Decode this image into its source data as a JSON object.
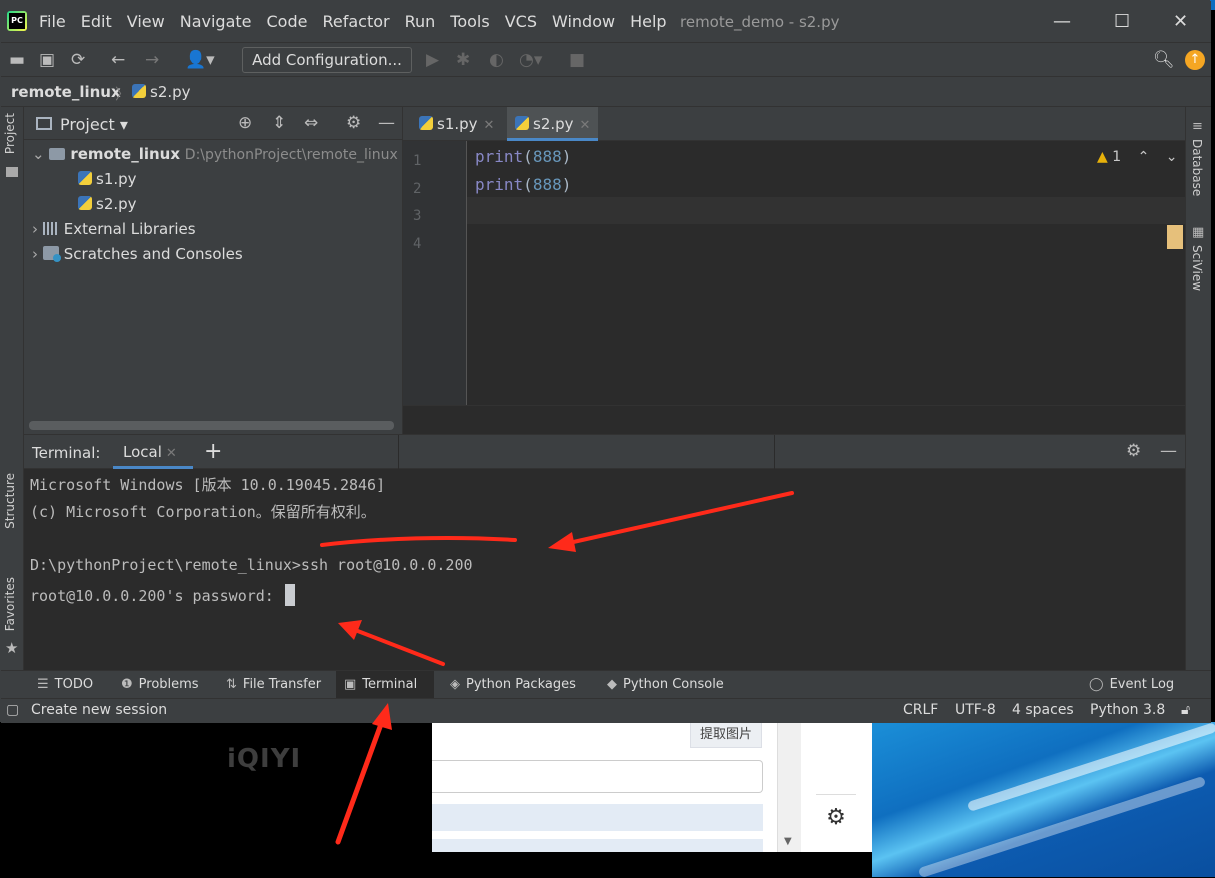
{
  "window": {
    "title": "remote_demo - s2.py",
    "controls": {
      "minimize": "—",
      "maximize": "☐",
      "close": "✕"
    }
  },
  "menu": [
    "File",
    "Edit",
    "View",
    "Navigate",
    "Code",
    "Refactor",
    "Run",
    "Tools",
    "VCS",
    "Window",
    "Help"
  ],
  "toolbar": {
    "add_configuration": "Add Configuration...",
    "icons": [
      "open-folder-icon",
      "save-icon",
      "sync-icon",
      "back-icon",
      "forward-icon",
      "user-icon",
      "run-icon",
      "debug-icon",
      "coverage-icon",
      "profile-icon",
      "stop-icon",
      "search-icon",
      "update-icon"
    ]
  },
  "breadcrumb": {
    "project": "remote_linux",
    "file": "s2.py"
  },
  "project_panel": {
    "title": "Project",
    "root": {
      "name": "remote_linux",
      "path": "D:\\pythonProject\\remote_linux"
    },
    "files": [
      "s1.py",
      "s2.py"
    ],
    "external": "External Libraries",
    "scratches": "Scratches and Consoles"
  },
  "left_strip": {
    "project": "Project",
    "structure": "Structure",
    "favorites": "Favorites"
  },
  "right_strip": {
    "database": "Database",
    "sciview": "SciView"
  },
  "editor": {
    "tabs": [
      {
        "label": "s1.py",
        "active": false
      },
      {
        "label": "s2.py",
        "active": true
      }
    ],
    "line_numbers": [
      "1",
      "2",
      "3",
      "4"
    ],
    "lines": [
      {
        "fn": "print",
        "open": "(",
        "arg": "888",
        "close": ")"
      },
      {
        "fn": "print",
        "open": "(",
        "arg": "888",
        "close": ")"
      }
    ],
    "warnings": "1"
  },
  "terminal": {
    "label": "Terminal:",
    "tab": "Local",
    "lines": [
      "Microsoft Windows [版本 10.0.19045.2846]",
      "(c) Microsoft Corporation。保留所有权利。",
      "",
      "D:\\pythonProject\\remote_linux>ssh root@10.0.0.200",
      "root@10.0.0.200's password: "
    ]
  },
  "tool_windows": [
    {
      "label": "TODO",
      "icon": "list-icon",
      "active": false
    },
    {
      "label": "Problems",
      "icon": "problems-icon",
      "active": false
    },
    {
      "label": "File Transfer",
      "icon": "transfer-icon",
      "active": false
    },
    {
      "label": "Terminal",
      "icon": "terminal-icon",
      "active": true
    },
    {
      "label": "Python Packages",
      "icon": "packages-icon",
      "active": false
    },
    {
      "label": "Python Console",
      "icon": "python-icon",
      "active": false
    },
    {
      "label": "Event Log",
      "icon": "event-log-icon",
      "active": false
    }
  ],
  "status": {
    "hint": "Create new session",
    "line_sep": "CRLF",
    "encoding": "UTF-8",
    "indent": "4 spaces",
    "interpreter": "Python 3.8"
  },
  "background": {
    "player_logo": "iQIYI",
    "dialog_button": "提取图片"
  },
  "colors": {
    "ide_bg": "#2b2b2b",
    "panel_bg": "#3c3f41",
    "accent": "#4a88c7",
    "annotation_red": "#ff2a1a"
  }
}
